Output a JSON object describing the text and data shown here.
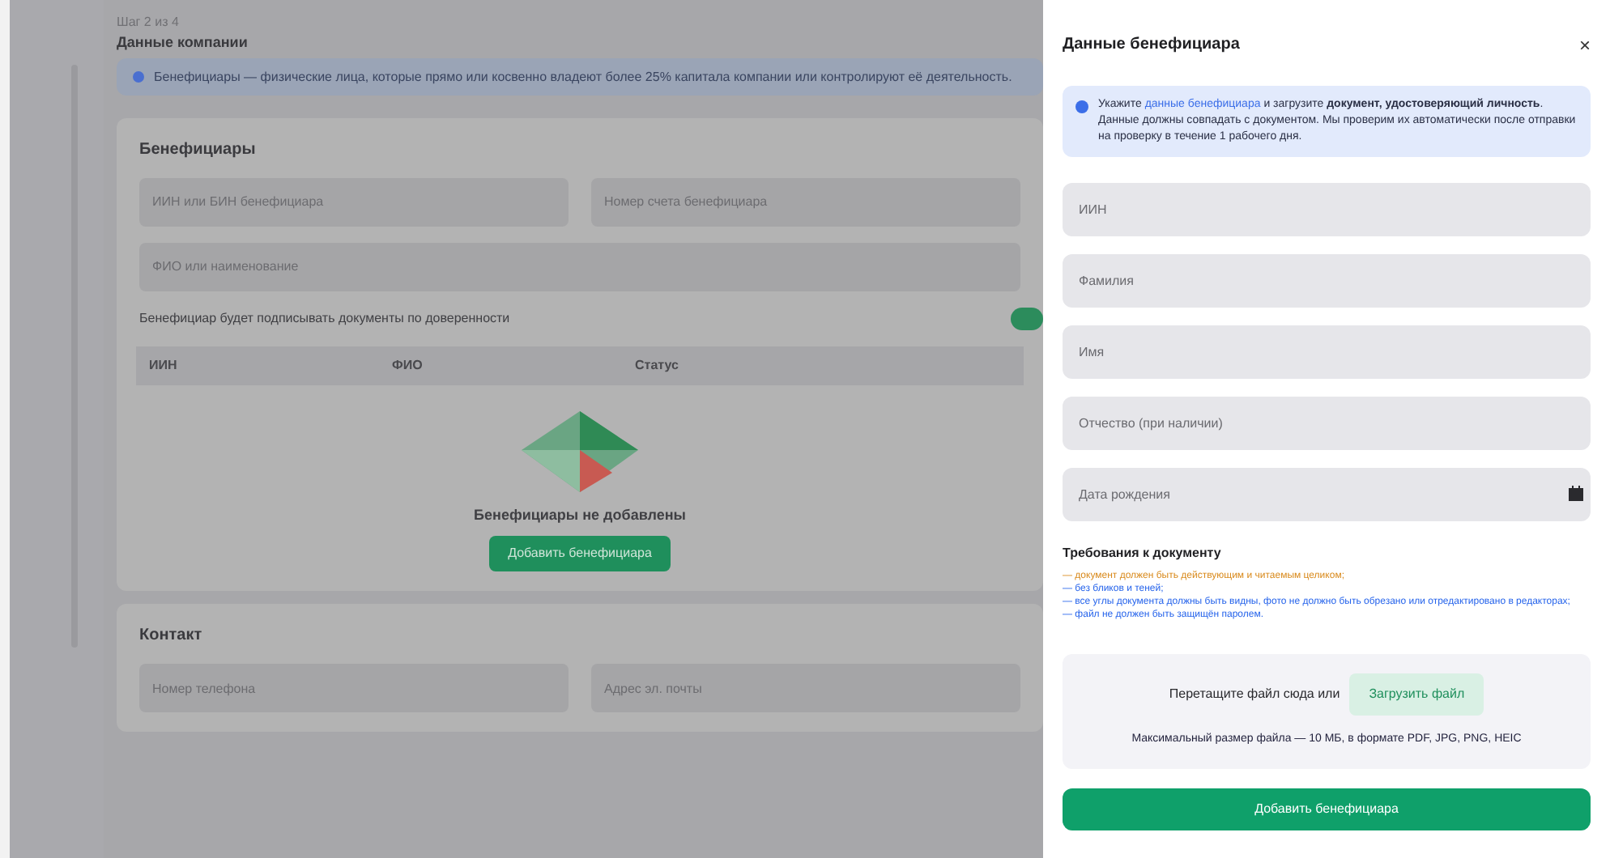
{
  "page": {
    "step": "Шаг 2 из 4",
    "title": "Данные компании",
    "info": "Бенефициары — физические лица, которые прямо или косвенно владеют более 25% капитала компании или контролируют её деятельность.",
    "beneficiaries": {
      "title": "Бенефициары",
      "fields": [
        {
          "placeholder": "ИИН или БИН бенефициара"
        },
        {
          "placeholder": "Номер счета бенефициара"
        }
      ],
      "field_wide": {
        "placeholder": "ФИО или наименование"
      },
      "toggle": {
        "label": "Бенефициар будет подписывать документы по доверенности",
        "on": true
      },
      "columns": [
        "ИИН",
        "ФИО",
        "Статус"
      ],
      "empty_text": "Бенефициары не добавлены",
      "add_button": "Добавить бенефициара"
    },
    "contact": {
      "title": "Контакт",
      "fields": [
        {
          "placeholder": "Номер телефона"
        },
        {
          "placeholder": "Адрес эл. почты"
        }
      ]
    }
  },
  "drawer": {
    "title": "Данные бенефициара",
    "close": "×",
    "info_parts": [
      {
        "text": "Укажите ",
        "kind": "plain"
      },
      {
        "text": "данные бенефициара",
        "kind": "link"
      },
      {
        "text": " и загрузите ",
        "kind": "plain"
      },
      {
        "text": "документ, удостоверяющий личность",
        "kind": "bold"
      },
      {
        "text": ". Данные должны совпадать с документом. Мы проверим их автоматически после отправки на проверку в течение 1 рабочего дня.",
        "kind": "plain"
      }
    ],
    "fields": [
      {
        "placeholder": "ИИН",
        "kind": "text"
      },
      {
        "placeholder": "Фамилия",
        "kind": "text"
      },
      {
        "placeholder": "Имя",
        "kind": "text"
      },
      {
        "placeholder": "Отчество (при наличии)",
        "kind": "text"
      },
      {
        "placeholder": "Дата рождения",
        "kind": "date"
      }
    ],
    "requirements_title": "Требования к документу",
    "requirements": [
      {
        "text": "— документ должен быть действующим и читаемым целиком;",
        "color": "#d98a1c"
      },
      {
        "text": "— без бликов и теней;",
        "color": "#2563eb"
      },
      {
        "text": "— все углы документа должны быть видны, фото не должно быть обрезано или отредактировано в редакторах;",
        "color": "#2563eb"
      },
      {
        "text": "— файл не должен быть защищён паролем.",
        "color": "#2563eb"
      }
    ],
    "upload": {
      "text": "Перетащите файл сюда или",
      "button": "Загрузить файл",
      "hint": "Максимальный размер файла — 10 МБ, в формате PDF, JPG, PNG, HEIC"
    },
    "submit": "Добавить бенефициара"
  }
}
